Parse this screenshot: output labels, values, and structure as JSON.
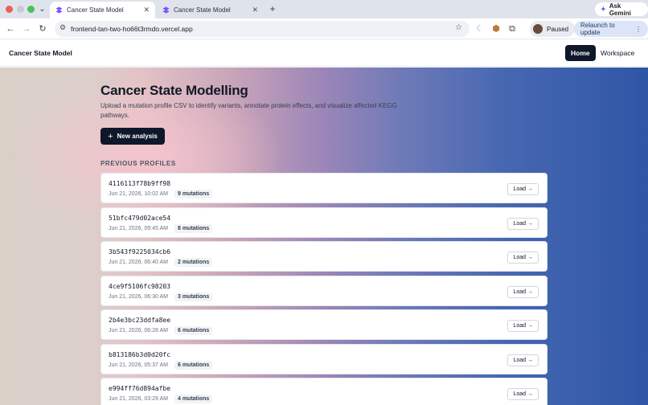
{
  "browser": {
    "tabs": [
      {
        "title": "Cancer State Model",
        "active": true
      },
      {
        "title": "Cancer State Model",
        "active": false
      }
    ],
    "ask_gemini": "Ask Gemini",
    "url": "frontend-tan-two-ho66t3rmdo.vercel.app",
    "profile_status": "Paused",
    "relaunch": "Relaunch to update"
  },
  "header": {
    "brand": "Cancer State Model",
    "nav": {
      "home": "Home",
      "workspace": "Workspace"
    }
  },
  "main": {
    "title": "Cancer State Modelling",
    "subtitle": "Upload a mutation profile CSV to identify variants, annotate protein effects, and visualize affected KEGG pathways.",
    "new_button": "New analysis",
    "section_title": "PREVIOUS PROFILES",
    "profiles": [
      {
        "id": "4116113f78b9ff98",
        "date": "Jun 21, 2026, 10:02 AM",
        "mutations": "9 mutations",
        "action": "Load →"
      },
      {
        "id": "51bfc479d02ace54",
        "date": "Jun 21, 2026, 09:45 AM",
        "mutations": "8 mutations",
        "action": "Load →"
      },
      {
        "id": "3b543f9225034cb6",
        "date": "Jun 21, 2026, 06:40 AM",
        "mutations": "2 mutations",
        "action": "Load →"
      },
      {
        "id": "4ce9f5106fc98203",
        "date": "Jun 21, 2026, 06:30 AM",
        "mutations": "3 mutations",
        "action": "Load →"
      },
      {
        "id": "2b4e3bc23ddfa8ee",
        "date": "Jun 21, 2026, 06:28 AM",
        "mutations": "6 mutations",
        "action": "Load →"
      },
      {
        "id": "b813186b3d0d20fc",
        "date": "Jun 21, 2026, 05:37 AM",
        "mutations": "6 mutations",
        "action": "Load →"
      },
      {
        "id": "e994ff76d894afbe",
        "date": "Jun 21, 2026, 03:29 AM",
        "mutations": "4 mutations",
        "action": "Load →"
      }
    ]
  },
  "colors": {
    "accent": "#0f172a",
    "favicon": "#7c4dff"
  }
}
